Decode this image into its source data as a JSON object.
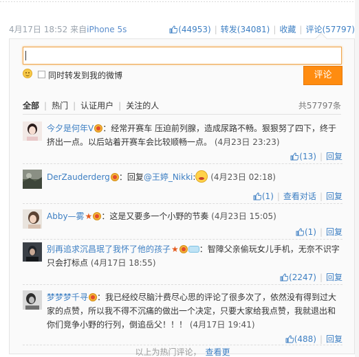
{
  "post": {
    "date": "4月17日 18:52",
    "source_prefix": "来自",
    "source_name": "iPhone 5s"
  },
  "actions": {
    "like": "(44953)",
    "repost": "转发(34081)",
    "favorite": "收藏",
    "comment": "评论(57797)"
  },
  "composer": {
    "input_value": "",
    "forward_label": "同时转发到我的微博",
    "submit_label": "评论"
  },
  "filters": {
    "items": [
      "全部",
      "热门",
      "认证用户",
      "关注的人"
    ],
    "total": "共57797条"
  },
  "comments": [
    {
      "user": "今夕是何年V",
      "body": "：经常开赛车 压迫前列腺，造成尿路不畅。狠狠努了四下，终于挤出一点。以后站着开赛车会比较顺畅一点。",
      "time": "(4月23日 23:23)",
      "likes": "(13)",
      "reply": "回复"
    },
    {
      "user": "DerZauderderg",
      "body_prefix": "：回复",
      "mention": "@王婷_Nikki",
      "body_suffix": ":",
      "time": "(4月23日 02:18)",
      "likes": "(1)",
      "view_thread": "查看对话",
      "reply": "回复"
    },
    {
      "user": "Abby—雾",
      "body": "：这是又要多一个小野的节奏",
      "time": "(4月23日 15:05)",
      "likes": "(1)",
      "reply": "回复"
    },
    {
      "user": "别再追求沉昌珉了我怀了他的孩子",
      "body": "：智障父亲偷玩女儿手机，无奈不识字只会打标点",
      "time": "(4月17日 18:55)",
      "likes": "(2247)",
      "reply": "回复"
    },
    {
      "user": "梦梦梦千寻",
      "body": "：我已经绞尽脑汁费尽心思的评论了很多次了，依然没有得到过大家的点赞，所以我不得不沉痛的做出一个决定，只要大家给我点赞，我就退出和你们竞争小野的行列，倒追岳父！！！",
      "time": "(4月17日 19:41)",
      "likes": "(488)",
      "reply": "回复"
    }
  ],
  "hot_note": {
    "text": "以上为热门评论，",
    "link": "查看更"
  },
  "colors": {
    "link": "#3d7fc3",
    "submit": "#ff8c10",
    "input_border": "#f0a54a"
  }
}
